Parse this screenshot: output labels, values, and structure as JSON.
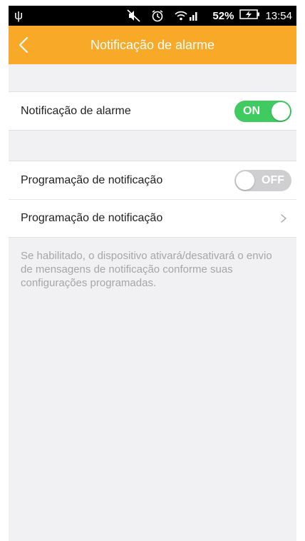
{
  "status_bar": {
    "usb_icon": "usb-icon",
    "mute_icon": "mute-icon",
    "alarm_icon": "alarm-clock-icon",
    "signal_icon": "wifi-signal-icon",
    "battery_percent": "52%",
    "battery_icon": "battery-charging-icon",
    "time": "13:54"
  },
  "app_bar": {
    "title": "Notificação de alarme",
    "back_icon": "chevron-left-icon",
    "color": "#f8a928"
  },
  "alarm_section": {
    "label": "Notificação de alarme",
    "toggle_state": "ON",
    "toggle_color": "#3fcb60"
  },
  "schedule_section": {
    "toggle_row_label": "Programação de notificação",
    "toggle_state": "OFF",
    "link_row_label": "Programação de notificação",
    "link_icon": "chevron-right-icon"
  },
  "hint_text": "Se habilitado, o dispositivo ativará/desativará o envio de mensagens de notificação conforme suas configurações programadas."
}
